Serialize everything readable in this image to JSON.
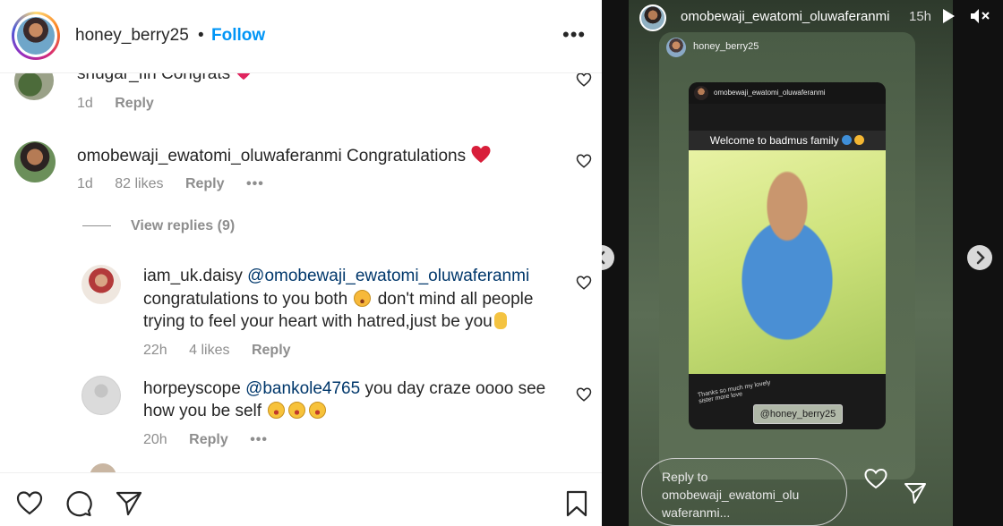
{
  "header": {
    "username": "honey_berry25",
    "separator": "•",
    "follow_label": "Follow",
    "more_label": "•••"
  },
  "comments": [
    {
      "username": "shugar_fin",
      "text": "Congrats",
      "time": "1d",
      "reply_label": "Reply"
    },
    {
      "username": "omobewaji_ewatomi_oluwaferanmi",
      "text": "Congratulations",
      "time": "1d",
      "likes": "82 likes",
      "reply_label": "Reply",
      "more": "•••"
    }
  ],
  "view_replies": "View replies (9)",
  "replies": [
    {
      "username": "iam_uk.daisy",
      "mention": "@omobewaji_ewatomi_oluwaferanmi",
      "line1": "congratulations to you both",
      "line1b": "don't mind all people",
      "line2": "trying to feel your heart with hatred,just be you",
      "time": "22h",
      "likes": "4 likes",
      "reply_label": "Reply"
    },
    {
      "username": "horpeyscope",
      "mention": "@bankole4765",
      "line1": "you day craze oooo see",
      "line2": "how you be self",
      "time": "20h",
      "reply_label": "Reply",
      "more": "•••"
    }
  ],
  "story": {
    "username": "omobewaji_ewatomi_oluwaferanmi",
    "time": "15h",
    "inner_username": "honey_berry25",
    "repost_username": "omobewaji_ewatomi_oluwaferanmi",
    "banner": "Welcome to badmus family",
    "thanks": "Thanks so much my lovely sister more love",
    "caption": "@honey_berry25",
    "reply_placeholder": "Reply to omobewaji_ewatomi_olu waferanmi..."
  },
  "colors": {
    "follow": "#0095f6",
    "heart_red": "#e0245e",
    "mention": "#00376b",
    "meta": "#8e8e8e"
  },
  "icons": [
    "heart-icon",
    "comment-icon",
    "share-icon",
    "bookmark-icon",
    "play-icon",
    "mute-icon",
    "send-icon",
    "prev-arrow-icon",
    "next-arrow-icon"
  ]
}
